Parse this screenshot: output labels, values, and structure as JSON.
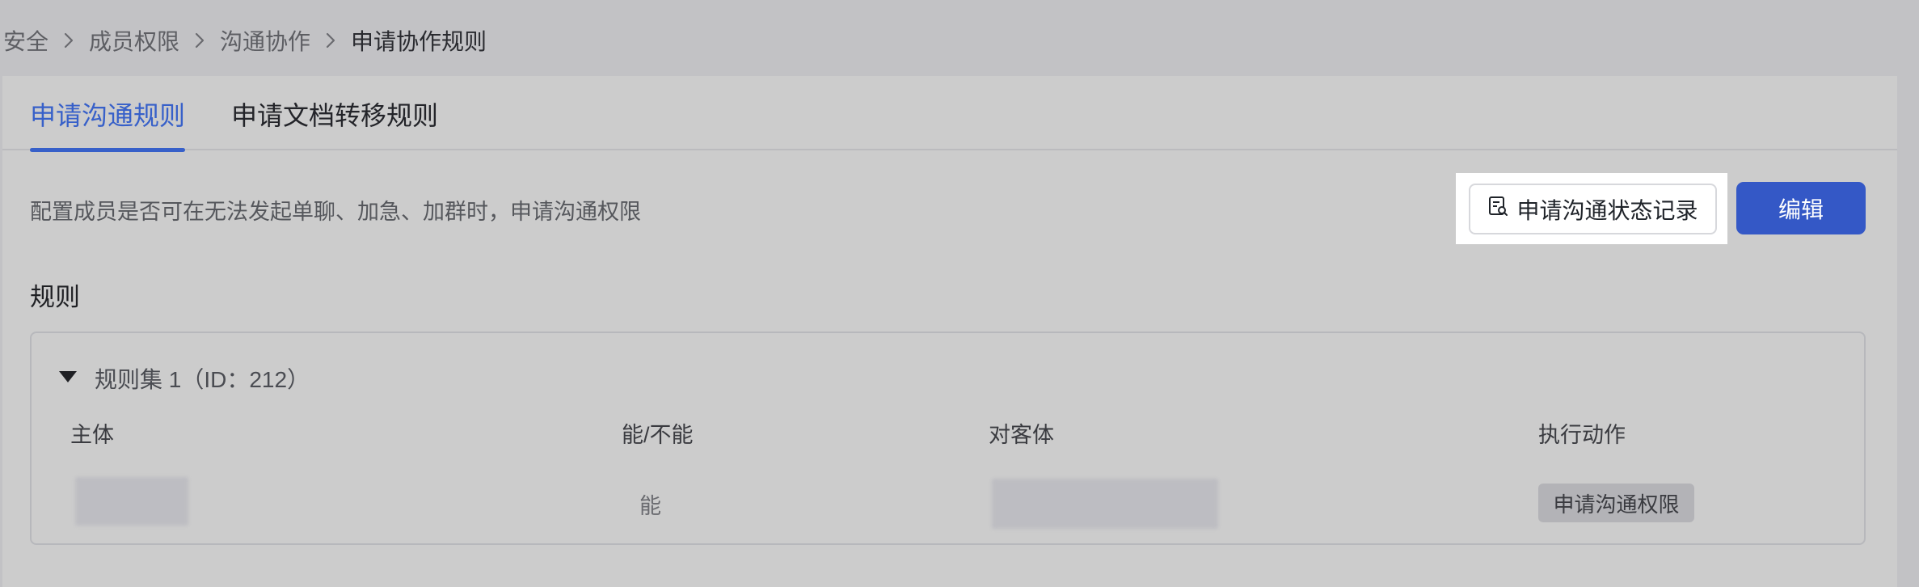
{
  "breadcrumb": {
    "items": [
      "安全",
      "成员权限",
      "沟通协作"
    ],
    "current": "申请协作规则"
  },
  "tabs": {
    "active": "申请沟通规则",
    "other": "申请文档转移规则"
  },
  "description": "配置成员是否可在无法发起单聊、加急、加群时，申请沟通权限",
  "buttons": {
    "record_label": "申请沟通状态记录",
    "edit_label": "编辑"
  },
  "section_title": "规则",
  "rule_set": {
    "title": "规则集 1（ID：212）",
    "columns": [
      "主体",
      "能/不能",
      "对客体",
      "执行动作"
    ],
    "row": {
      "can": "能",
      "action": "申请沟通权限"
    }
  },
  "colors": {
    "accent": "#3760c9",
    "primary_button": "#3458c6",
    "overlay_background": "#c2c2c5"
  },
  "icons": {
    "breadcrumb_separator": "chevron-right-icon",
    "record_button": "document-record-icon",
    "rule_toggle": "caret-down-icon"
  }
}
